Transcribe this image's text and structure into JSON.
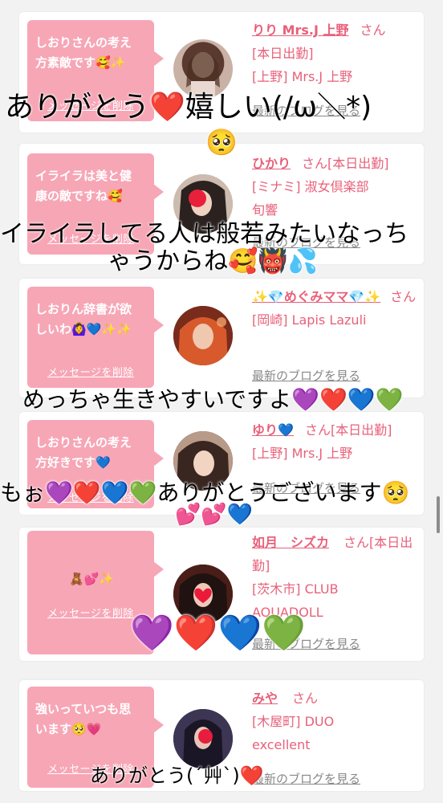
{
  "cards": [
    {
      "message": "しおりさんの考え\n方素敵です🥰✨",
      "delete": "メッセージを削除",
      "name": "りり Mrs.J 上野",
      "san": "さん",
      "detail": "[本日出勤]\n[上野] Mrs.J 上野",
      "blog": "最新のブログを見る",
      "avatar_icon": "woman-portrait-icon"
    },
    {
      "message": "イライラは美と健\n康の敵ですね🥰",
      "delete": "メッセージを削除",
      "name": "ひかり",
      "san": "さん[本日出勤]",
      "detail": "[ミナミ] 淑女倶楽部\n旬響",
      "blog": "最新のブログを見る",
      "avatar_icon": "woman-portrait-icon"
    },
    {
      "message": "しおりん辞書が欲\nしいわ🙆‍♀️💙✨✨",
      "delete": "メッセージを削除",
      "name": "✨💎めぐみママ💎✨",
      "san": "さん",
      "detail": "[岡崎] Lapis Lazuli",
      "blog": "最新のブログを見る",
      "avatar_icon": "woman-portrait-icon"
    },
    {
      "message": "しおりさんの考え\n方好きです💙",
      "delete": "メッセージを削除",
      "name": "ゆり💙",
      "san": "さん[本日出勤]",
      "detail": "[上野] Mrs.J 上野",
      "blog": "最新のブログを見る",
      "avatar_icon": "woman-portrait-icon"
    },
    {
      "message": "🧸💕✨",
      "delete": "メッセージを削除",
      "name": "如月　シズカ",
      "san": "さん[本日出勤]",
      "detail": "[茨木市] CLUB\nAQUADOLL",
      "blog": "最新のブログを見る",
      "avatar_icon": "woman-portrait-icon"
    },
    {
      "message": "強いっていつも思\nいます🥺💗",
      "delete": "メッセージを削除",
      "name": "みや",
      "san": "さん",
      "detail": "[木屋町] DUO\nexcellent",
      "blog": "最新のブログを見る",
      "avatar_icon": "woman-portrait-icon"
    }
  ],
  "overlays": {
    "o1": "ありがとう❤️嬉しい(/ω＼*)",
    "o1b": "🥺",
    "o2": "イライラしてる人は般若みたいなっち",
    "o2b": "ゃうからね🥰👹💦",
    "o3": "めっちゃ生きやすいですよ💜❤️💙💚",
    "o4": "もぉ💜❤️💙💚ありがとうございます🥺",
    "o4b": "💕💕💙",
    "o5": "💜❤️💙💚",
    "o6": "ありがとう(´艸`)❤️"
  },
  "colors": {
    "bubble": "#f7a6b6",
    "name_pink": "#e8607a",
    "background": "#f2f2f2"
  }
}
